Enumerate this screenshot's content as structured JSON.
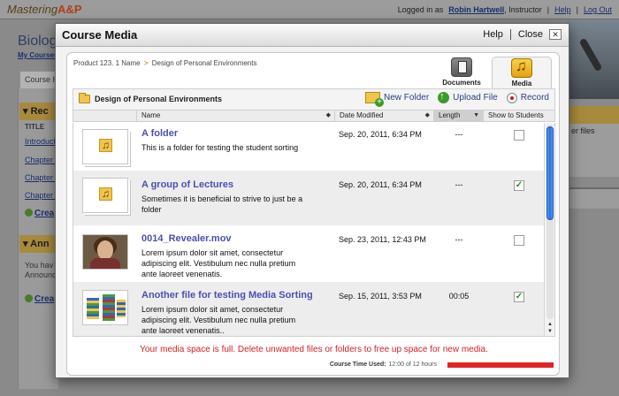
{
  "background": {
    "logo_text": "Mastering",
    "logo_suffix": "A&P",
    "logged_in_prefix": "Logged in as",
    "user_name": "Robin Hartwell",
    "user_role": ", Instructor",
    "help": "Help",
    "logout": "Log Out",
    "course_title": "Biolog",
    "my_courses": "My Courses",
    "tab_label": "Course H",
    "recent_header": "Rec",
    "title_header": "TITLE",
    "list_items": [
      "Introducti",
      "Chapter 1",
      "Chapter 2",
      "Chapter 3"
    ],
    "create_label": "Crea",
    "announcements_header": "Ann",
    "announce_text_1": "You hav",
    "announce_text_2": "Announc",
    "create_label_2": "Crea",
    "right_text": "er files"
  },
  "modal": {
    "title": "Course Media",
    "help": "Help",
    "close": "Close",
    "close_x": "✕",
    "breadcrumb": {
      "product": "Product 123. 1 Name",
      "separator": ">",
      "current": "Design of Personal Environments"
    },
    "tabs": [
      {
        "label": "Documents",
        "icon": "documents-icon",
        "active": false
      },
      {
        "label": "Media",
        "icon": "media-icon",
        "active": true
      }
    ],
    "folder_name": "Design of Personal Environments",
    "actions": {
      "new_folder": "New Folder",
      "upload_file": "Upload File",
      "record": "Record"
    },
    "columns": {
      "name": "Name",
      "date": "Date Modified",
      "length": "Length",
      "show": "Show to Students"
    },
    "rows": [
      {
        "name": "A folder",
        "desc": "This is a folder for testing the student sorting",
        "date": "Sep. 20, 2011, 6:34 PM",
        "length": "---",
        "checked": false,
        "thumb": "folder"
      },
      {
        "name": "A group of Lectures",
        "desc": "Sometimes it is beneficial to strive to just be a folder",
        "date": "Sep. 20, 2011, 6:34 PM",
        "length": "---",
        "checked": true,
        "thumb": "folder"
      },
      {
        "name": "0014_Revealer.mov",
        "desc": "Lorem ipsum dolor sit amet, consectetur adipiscing elit. Vestibulum nec nulla pretium ante laoreet venenatis.",
        "date": "Sep. 23, 2011, 12:43 PM",
        "length": "---",
        "checked": false,
        "thumb": "video"
      },
      {
        "name": "Another file for testing Media Sorting",
        "desc": "Lorem ipsum dolor sit amet, consectetur adipiscing elit. Vestibulum nec nulla pretium ante laoreet venenatis..",
        "date": "Sep. 15, 2011, 3:53 PM",
        "length": "00:05",
        "checked": true,
        "thumb": "chart"
      }
    ],
    "warning": "Your media space is full. Delete unwanted files or folders to free up space for new media.",
    "usage_label": "Course Time Used:",
    "usage_value": "12:00 of 12 hours",
    "usage_fraction": 1.0,
    "colors": {
      "warning": "#d62020",
      "link": "#4b4fb0",
      "usage_bar": "#e02525"
    }
  }
}
